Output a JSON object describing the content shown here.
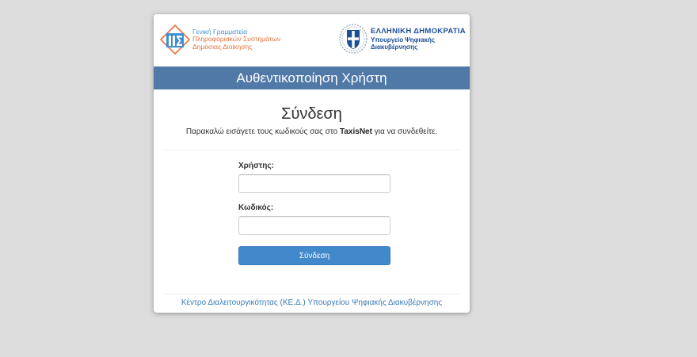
{
  "header": {
    "gsis_logo": {
      "line1": "Γενική Γραμματεία",
      "line2": "Πληροφοριακών Συστημάτων",
      "line3": "Δημόσιας Διοίκησης",
      "icon": "gsis-logo-icon"
    },
    "gov_logo": {
      "line1": "ΕΛΛΗΝΙΚΗ ΔΗΜΟΚΡΑΤΙΑ",
      "line2": "Υπουργείο Ψηφιακής",
      "line3": "Διακυβέρνησης",
      "icon": "hellenic-emblem-icon"
    }
  },
  "banner": {
    "title": "Αυθεντικοποίηση Χρήστη"
  },
  "login": {
    "heading": "Σύνδεση",
    "instruction_prefix": "Παρακαλώ εισάγετε τους κωδικούς σας στο ",
    "instruction_brand": "TaxisNet",
    "instruction_suffix": " για να συνδεθείτε.",
    "username_label": "Χρήστης:",
    "username_value": "",
    "password_label": "Κωδικός:",
    "password_value": "",
    "submit_label": "Σύνδεση"
  },
  "footer": {
    "link_text": "Κέντρο Διαλειτουργικότητας (ΚΕ.Δ.) Υπουργείου Ψηφιακής Διακυβέρνησης"
  },
  "colors": {
    "banner": "#5079a8",
    "button": "#4189cb",
    "link": "#3a7ab8",
    "gsis_orange": "#e8703a",
    "gsis_blue": "#3b8fd3",
    "gov_blue": "#1a4f9b"
  }
}
